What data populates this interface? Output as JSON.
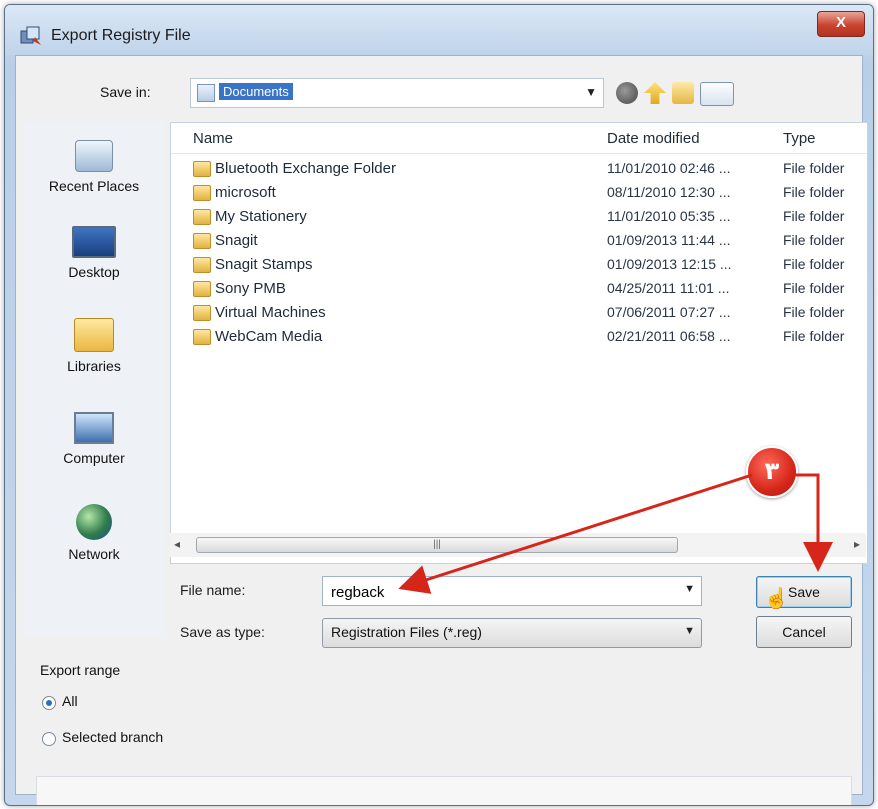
{
  "window": {
    "title": "Export Registry File",
    "close_label": "X"
  },
  "toolbar": {
    "save_in_label": "Save in:",
    "save_in_value": "Documents",
    "icons": [
      "back-icon",
      "up-folder-icon",
      "new-folder-icon",
      "views-menu-icon"
    ]
  },
  "places": [
    {
      "label": "Recent Places",
      "icon": "recent-places-icon"
    },
    {
      "label": "Desktop",
      "icon": "desktop-icon"
    },
    {
      "label": "Libraries",
      "icon": "libraries-icon"
    },
    {
      "label": "Computer",
      "icon": "computer-icon"
    },
    {
      "label": "Network",
      "icon": "network-icon"
    }
  ],
  "filelist": {
    "columns": {
      "name": "Name",
      "date": "Date modified",
      "type": "Type"
    },
    "rows": [
      {
        "name": "Bluetooth Exchange Folder",
        "date": "11/01/2010 02:46 ...",
        "type": "File folder"
      },
      {
        "name": "microsoft",
        "date": "08/11/2010 12:30 ...",
        "type": "File folder"
      },
      {
        "name": "My Stationery",
        "date": "11/01/2010 05:35 ...",
        "type": "File folder"
      },
      {
        "name": "Snagit",
        "date": "01/09/2013 11:44 ...",
        "type": "File folder"
      },
      {
        "name": "Snagit Stamps",
        "date": "01/09/2013 12:15 ...",
        "type": "File folder"
      },
      {
        "name": "Sony PMB",
        "date": "04/25/2011 11:01 ...",
        "type": "File folder"
      },
      {
        "name": "Virtual Machines",
        "date": "07/06/2011 07:27 ...",
        "type": "File folder"
      },
      {
        "name": "WebCam Media",
        "date": "02/21/2011 06:58 ...",
        "type": "File folder"
      }
    ]
  },
  "form": {
    "file_name_label": "File name:",
    "file_name_value": "regback",
    "save_as_type_label": "Save as type:",
    "save_as_type_value": "Registration Files (*.reg)",
    "save_label": "Save",
    "cancel_label": "Cancel"
  },
  "export_range": {
    "label": "Export range",
    "options": [
      {
        "label": "All",
        "selected": true
      },
      {
        "label": "Selected branch",
        "selected": false
      }
    ]
  },
  "annotation": {
    "step_number": "۳",
    "color": "#d6261a"
  }
}
